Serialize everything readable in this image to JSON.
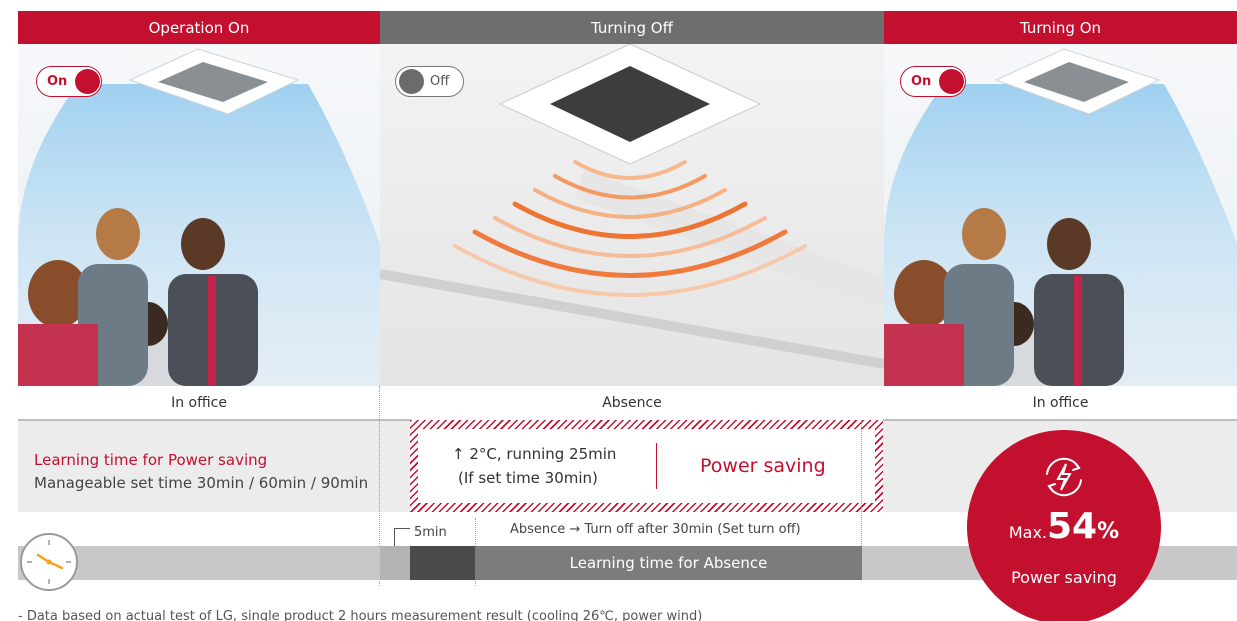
{
  "headers": {
    "operation_on": "Operation On",
    "turning_off": "Turning Off",
    "turning_on": "Turning On"
  },
  "toggles": {
    "left": "On",
    "middle": "Off",
    "right": "On"
  },
  "locations": {
    "left": "In office",
    "middle": "Absence",
    "right": "In office"
  },
  "learning": {
    "title": "Learning time for Power saving",
    "subtitle": "Manageable set time 30min / 60min / 90min"
  },
  "absence_box": {
    "line1": "↑ 2°C, running 25min",
    "line2": "(If set time 30min)",
    "power_saving": "Power saving"
  },
  "timeline": {
    "five_min": "5min",
    "absence_note": "Absence → Turn off after 30min (Set turn off)",
    "bar_label": "Learning time for Absence"
  },
  "badge": {
    "max_label": "Max.",
    "value": "54",
    "unit": "%",
    "caption": "Power saving"
  },
  "footnote": "- Data based on actual test of LG, single product 2 hours measurement result (cooling 26℃, power wind)",
  "colors": {
    "brand_red": "#c4102f",
    "header_grey": "#6e6e6e",
    "band_grey": "#ececec",
    "bar_grey": "#c8c8c8",
    "bar_dark": "#4a4a4a",
    "heat_orange": "#f07a3c"
  },
  "icons": {
    "clock": "clock-icon",
    "power_saving": "power-saving-icon"
  }
}
